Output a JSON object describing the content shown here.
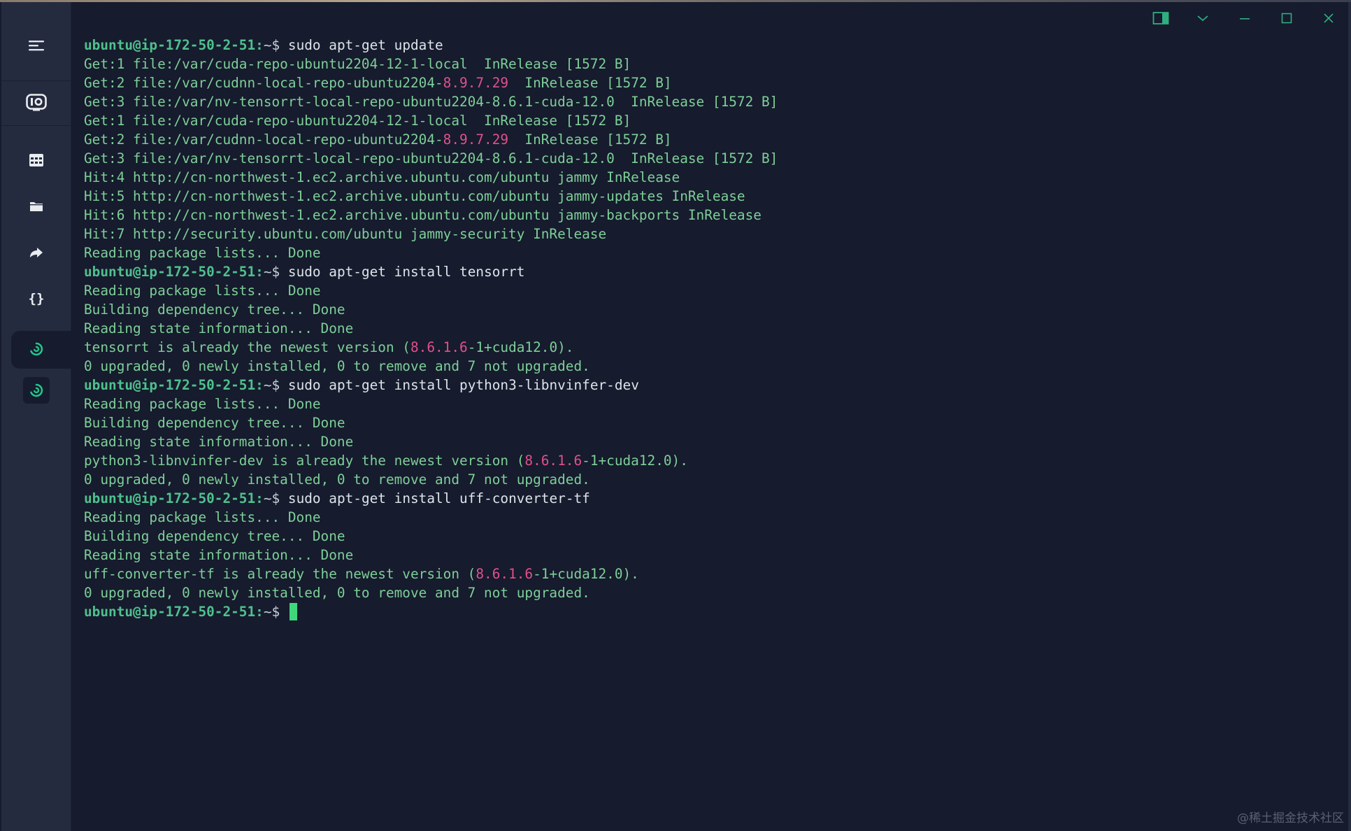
{
  "sidebar": {
    "items": [
      {
        "icon": "hamburger-menu-icon"
      },
      {
        "icon": "io-monitor-icon"
      },
      {
        "icon": "grid-table-icon"
      },
      {
        "icon": "folder-icon"
      },
      {
        "icon": "forward-arrow-icon"
      },
      {
        "icon": "braces-icon"
      },
      {
        "icon": "spiral-app-icon",
        "active": true
      },
      {
        "icon": "spiral-app-icon"
      }
    ]
  },
  "window_controls": [
    "split-pane-icon",
    "chevron-down-icon",
    "minimize-icon",
    "maximize-icon",
    "close-icon"
  ],
  "colors": {
    "background": "#161b2d",
    "sidebar": "#252b3f",
    "output_text": "#7ecf98",
    "prompt": "#4fc08d",
    "command": "#dde4ea",
    "number_highlight": "#e0508c",
    "cursor": "#3fd67c"
  },
  "terminal": {
    "prompt_user": "ubuntu@ip-172-50-2-51:",
    "prompt_path": "~",
    "prompt_symbol": "$",
    "lines": [
      {
        "type": "cmd",
        "text": "sudo apt-get update"
      },
      {
        "type": "out",
        "parts": [
          "Get:1 file:/var/cuda-repo-ubuntu2204-12-1-local  InRelease [1572 B]"
        ]
      },
      {
        "type": "out",
        "parts": [
          "Get:2 file:/var/cudnn-local-repo-ubuntu2204-",
          "8.9.7.29",
          "  InRelease [1572 B]"
        ]
      },
      {
        "type": "out",
        "parts": [
          "Get:3 file:/var/nv-tensorrt-local-repo-ubuntu2204-8.6.1-cuda-12.0  InRelease [1572 B]"
        ]
      },
      {
        "type": "out",
        "parts": [
          "Get:1 file:/var/cuda-repo-ubuntu2204-12-1-local  InRelease [1572 B]"
        ]
      },
      {
        "type": "out",
        "parts": [
          "Get:2 file:/var/cudnn-local-repo-ubuntu2204-",
          "8.9.7.29",
          "  InRelease [1572 B]"
        ]
      },
      {
        "type": "out",
        "parts": [
          "Get:3 file:/var/nv-tensorrt-local-repo-ubuntu2204-8.6.1-cuda-12.0  InRelease [1572 B]"
        ]
      },
      {
        "type": "out",
        "parts": [
          "Hit:4 http://cn-northwest-1.ec2.archive.ubuntu.com/ubuntu jammy InRelease"
        ]
      },
      {
        "type": "out",
        "parts": [
          "Hit:5 http://cn-northwest-1.ec2.archive.ubuntu.com/ubuntu jammy-updates InRelease"
        ]
      },
      {
        "type": "out",
        "parts": [
          "Hit:6 http://cn-northwest-1.ec2.archive.ubuntu.com/ubuntu jammy-backports InRelease"
        ]
      },
      {
        "type": "out",
        "parts": [
          "Hit:7 http://security.ubuntu.com/ubuntu jammy-security InRelease"
        ]
      },
      {
        "type": "out",
        "parts": [
          "Reading package lists... Done"
        ]
      },
      {
        "type": "cmd",
        "text": "sudo apt-get install tensorrt"
      },
      {
        "type": "out",
        "parts": [
          "Reading package lists... Done"
        ]
      },
      {
        "type": "out",
        "parts": [
          "Building dependency tree... Done"
        ]
      },
      {
        "type": "out",
        "parts": [
          "Reading state information... Done"
        ]
      },
      {
        "type": "out",
        "parts": [
          "tensorrt is already the newest version (",
          "8.6.1.6",
          "-1+cuda12.0)."
        ]
      },
      {
        "type": "out",
        "parts": [
          "0 upgraded, 0 newly installed, 0 to remove and 7 not upgraded."
        ]
      },
      {
        "type": "cmd",
        "text": "sudo apt-get install python3-libnvinfer-dev"
      },
      {
        "type": "out",
        "parts": [
          "Reading package lists... Done"
        ]
      },
      {
        "type": "out",
        "parts": [
          "Building dependency tree... Done"
        ]
      },
      {
        "type": "out",
        "parts": [
          "Reading state information... Done"
        ]
      },
      {
        "type": "out",
        "parts": [
          "python3-libnvinfer-dev is already the newest version (",
          "8.6.1.6",
          "-1+cuda12.0)."
        ]
      },
      {
        "type": "out",
        "parts": [
          "0 upgraded, 0 newly installed, 0 to remove and 7 not upgraded."
        ]
      },
      {
        "type": "cmd",
        "text": "sudo apt-get install uff-converter-tf"
      },
      {
        "type": "out",
        "parts": [
          "Reading package lists... Done"
        ]
      },
      {
        "type": "out",
        "parts": [
          "Building dependency tree... Done"
        ]
      },
      {
        "type": "out",
        "parts": [
          "Reading state information... Done"
        ]
      },
      {
        "type": "out",
        "parts": [
          "uff-converter-tf is already the newest version (",
          "8.6.1.6",
          "-1+cuda12.0)."
        ]
      },
      {
        "type": "out",
        "parts": [
          "0 upgraded, 0 newly installed, 0 to remove and 7 not upgraded."
        ]
      },
      {
        "type": "prompt",
        "text": ""
      }
    ]
  },
  "watermark": "@稀土掘金技术社区"
}
